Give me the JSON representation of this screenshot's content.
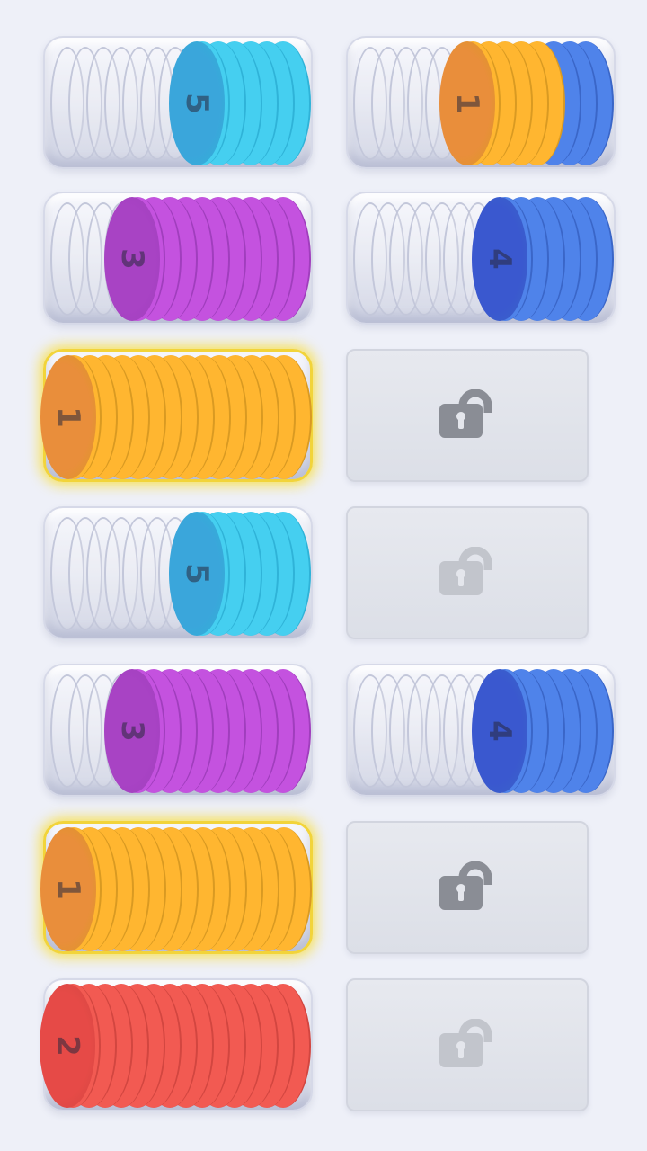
{
  "colors": {
    "orange": {
      "body": "#ffb630",
      "face": "#e98e3b",
      "edge": "#d99a22"
    },
    "cyan": {
      "body": "#45cff0",
      "face": "#3aa6db",
      "edge": "#2fb3d8"
    },
    "purple": {
      "body": "#c452df",
      "face": "#a843c4",
      "edge": "#a03ebd"
    },
    "blue": {
      "body": "#4f83ea",
      "face": "#3a58cf",
      "edge": "#3a66c8"
    },
    "red": {
      "body": "#f25a52",
      "face": "#e64a47",
      "edge": "#d24640"
    }
  },
  "lock_icon": "padlock-icon",
  "slots": [
    {
      "id": "l1",
      "type": "tube",
      "selected": false,
      "stack": [
        {
          "color": "cyan",
          "count": 6
        }
      ],
      "top_label": "5"
    },
    {
      "id": "r1",
      "type": "tube",
      "selected": false,
      "stack": [
        {
          "color": "blue",
          "count": 3
        },
        {
          "color": "orange",
          "count": 5
        }
      ],
      "top_label": "1"
    },
    {
      "id": "l2",
      "type": "tube",
      "selected": false,
      "stack": [
        {
          "color": "purple",
          "count": 10
        }
      ],
      "top_label": "3"
    },
    {
      "id": "r2",
      "type": "tube",
      "selected": false,
      "stack": [
        {
          "color": "blue",
          "count": 6
        }
      ],
      "top_label": "4"
    },
    {
      "id": "l3",
      "type": "tube",
      "selected": true,
      "stack": [
        {
          "color": "orange",
          "count": 14
        }
      ],
      "top_label": "1"
    },
    {
      "id": "r3",
      "type": "locked",
      "lock_shade": "dark"
    },
    {
      "id": "l4",
      "type": "tube",
      "selected": false,
      "stack": [
        {
          "color": "cyan",
          "count": 6
        }
      ],
      "top_label": "5"
    },
    {
      "id": "r4",
      "type": "locked",
      "lock_shade": "light"
    },
    {
      "id": "l5",
      "type": "tube",
      "selected": false,
      "stack": [
        {
          "color": "purple",
          "count": 10
        }
      ],
      "top_label": "3"
    },
    {
      "id": "r5",
      "type": "tube",
      "selected": false,
      "stack": [
        {
          "color": "blue",
          "count": 6
        }
      ],
      "top_label": "4"
    },
    {
      "id": "l6",
      "type": "tube",
      "selected": true,
      "stack": [
        {
          "color": "orange",
          "count": 14
        }
      ],
      "top_label": "1"
    },
    {
      "id": "r6",
      "type": "locked",
      "lock_shade": "dark"
    },
    {
      "id": "l7",
      "type": "tube",
      "selected": false,
      "stack": [
        {
          "color": "red",
          "count": 14
        }
      ],
      "top_label": "2"
    },
    {
      "id": "r7",
      "type": "locked",
      "lock_shade": "light"
    }
  ]
}
